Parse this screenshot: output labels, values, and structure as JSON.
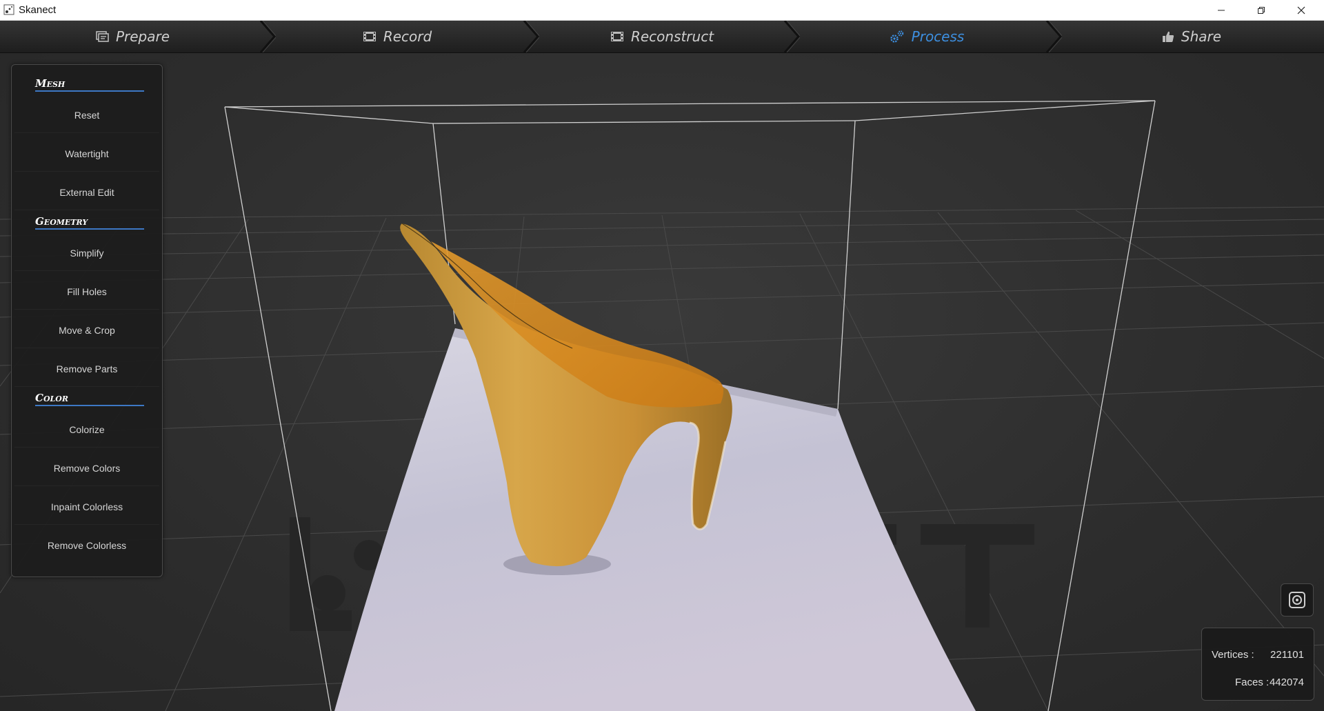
{
  "window": {
    "title": "Skanect"
  },
  "steps": [
    {
      "label": "Prepare",
      "icon": "prepare-icon"
    },
    {
      "label": "Record",
      "icon": "film-icon"
    },
    {
      "label": "Reconstruct",
      "icon": "film-icon"
    },
    {
      "label": "Process",
      "icon": "gears-icon",
      "active": true
    },
    {
      "label": "Share",
      "icon": "thumbs-up-icon"
    }
  ],
  "panel": {
    "sections": [
      {
        "title": "Mesh",
        "items": [
          "Reset",
          "Watertight",
          "External Edit"
        ]
      },
      {
        "title": "Geometry",
        "items": [
          "Simplify",
          "Fill Holes",
          "Move & Crop",
          "Remove Parts"
        ]
      },
      {
        "title": "Color",
        "items": [
          "Colorize",
          "Remove Colors",
          "Inpaint Colorless",
          "Remove Colorless"
        ]
      }
    ]
  },
  "stats": {
    "vertices_label": "Vertices :",
    "vertices_value": "221101",
    "faces_label": "Faces :",
    "faces_value": "442074"
  },
  "colors": {
    "accent": "#3d8fe0",
    "section_underline": "#3d78c5",
    "model": "#d59a3a",
    "table": "#c9c6d6"
  }
}
